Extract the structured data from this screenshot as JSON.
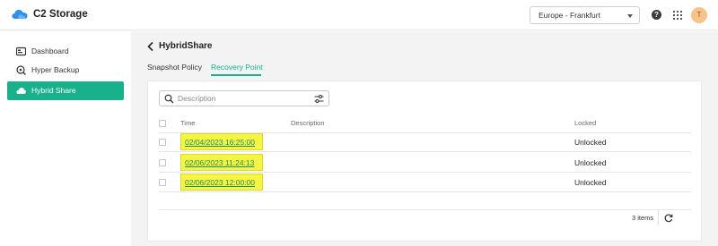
{
  "header": {
    "app_title": "C2 Storage",
    "logo_icon": "cloud-logo-icon",
    "region": "Europe - Frankfurt",
    "help_glyph": "?",
    "avatar_initial": "T",
    "brand_color": "#19b08c"
  },
  "sidebar": {
    "items": [
      {
        "label": "Dashboard",
        "icon": "dashboard-icon",
        "active": false
      },
      {
        "label": "Hyper Backup",
        "icon": "hyper-backup-icon",
        "active": false
      },
      {
        "label": "Hybrid Share",
        "icon": "cloud-icon",
        "active": true
      }
    ]
  },
  "page": {
    "title": "HybridShare",
    "tabs": [
      {
        "label": "Snapshot Policy",
        "active": false
      },
      {
        "label": "Recovery Point",
        "active": true
      }
    ]
  },
  "search": {
    "placeholder": "Description",
    "value": ""
  },
  "table": {
    "columns": [
      "Time",
      "Description",
      "Locked"
    ],
    "rows": [
      {
        "time": "02/04/2023 16:25:00",
        "description": "",
        "locked": "Unlocked"
      },
      {
        "time": "02/06/2023 11:24:13",
        "description": "",
        "locked": "Unlocked"
      },
      {
        "time": "02/06/2023 12:00:00",
        "description": "",
        "locked": "Unlocked"
      }
    ]
  },
  "footer": {
    "items_count": "3 items"
  }
}
